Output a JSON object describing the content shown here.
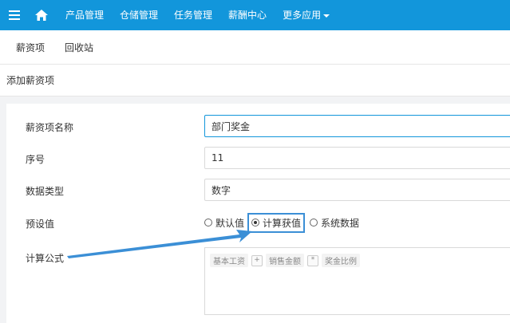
{
  "topnav": {
    "items": [
      "产品管理",
      "仓储管理",
      "任务管理",
      "薪酬中心",
      "更多应用"
    ]
  },
  "subtabs": [
    "薪资项",
    "回收站"
  ],
  "section_title": "添加薪资项",
  "form": {
    "name": {
      "label": "薪资项名称",
      "value": "部门奖金"
    },
    "order": {
      "label": "序号",
      "value": "11"
    },
    "data_type": {
      "label": "数据类型",
      "value": "数字"
    },
    "preset": {
      "label": "预设值",
      "options": [
        "默认值",
        "计算获值",
        "系统数据"
      ],
      "selected": "计算获值"
    },
    "formula": {
      "label": "计算公式",
      "tokens": [
        "基本工资",
        "销售金额",
        "奖金比例"
      ],
      "operators": [
        "+",
        "*"
      ]
    }
  },
  "colors": {
    "nav_bg": "#1296db",
    "highlight_box": "#3b8fd6",
    "arrow": "#3b8fd6"
  }
}
